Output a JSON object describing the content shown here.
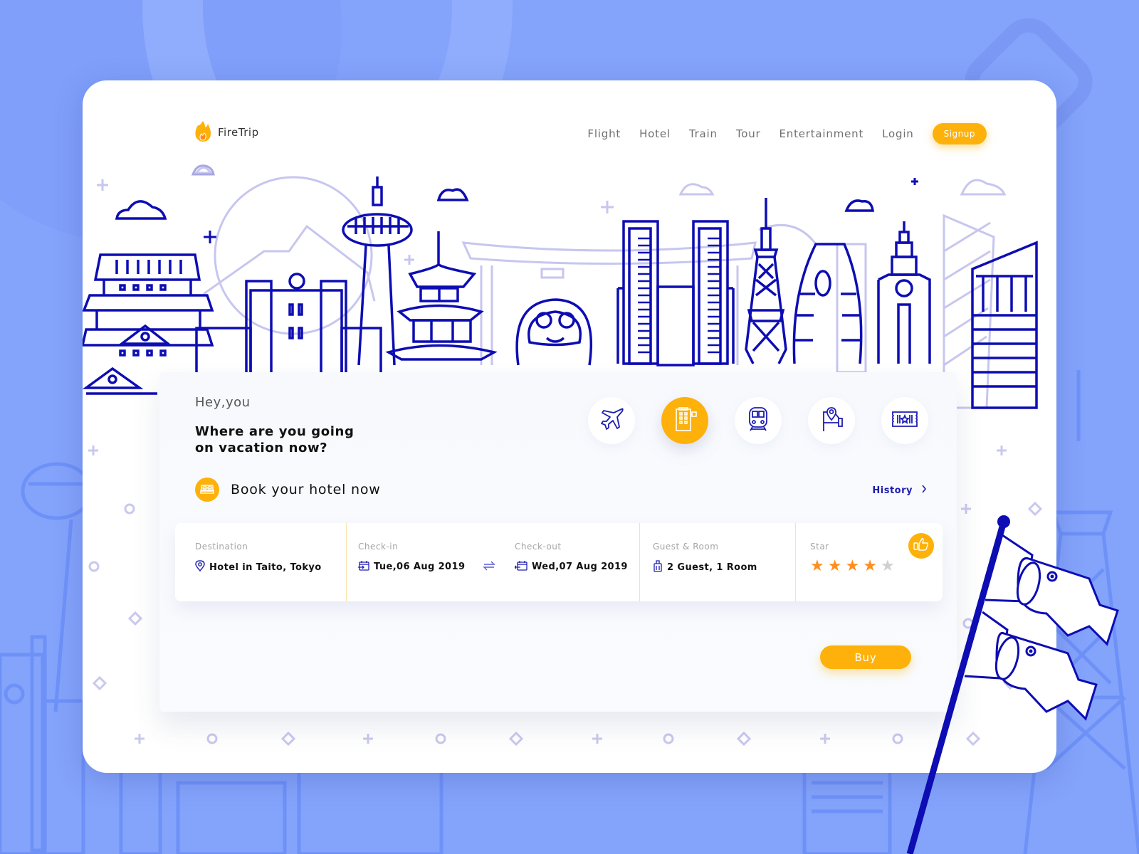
{
  "brand": {
    "name": "FireTrip",
    "icon": "flame-icon",
    "accent": "#fdb10a",
    "ink": "#0d0db3"
  },
  "nav": {
    "links": [
      "Flight",
      "Hotel",
      "Train",
      "Tour",
      "Entertainment",
      "Login"
    ],
    "signup_label": "Signup"
  },
  "hero": {
    "greeting": "Hey,you",
    "question_line1": "Where are you going",
    "question_line2": "on vacation now?"
  },
  "categories": [
    {
      "name": "flight",
      "icon": "airplane-icon",
      "active": false
    },
    {
      "name": "hotel",
      "icon": "hotel-building-icon",
      "active": true
    },
    {
      "name": "train",
      "icon": "train-icon",
      "active": false
    },
    {
      "name": "tour",
      "icon": "map-pin-flag-icon",
      "active": false
    },
    {
      "name": "entertainment",
      "icon": "ticket-icon",
      "active": false
    }
  ],
  "booking": {
    "title": "Book your hotel now",
    "title_icon": "bed-icon",
    "history_label": "History",
    "fields": {
      "destination": {
        "label": "Destination",
        "value": "Hotel in Taito, Tokyo",
        "icon": "location-pin-icon"
      },
      "checkin": {
        "label": "Check-in",
        "value": "Tue,06 Aug 2019",
        "icon": "calendar-in-icon"
      },
      "checkout": {
        "label": "Check-out",
        "value": "Wed,07 Aug 2019",
        "icon": "calendar-out-icon"
      },
      "guest": {
        "label": "Guest & Room",
        "value": "2 Guest, 1 Room",
        "icon": "luggage-icon"
      },
      "star": {
        "label": "Star",
        "rating": 4,
        "max": 5
      }
    },
    "star_color": "#fe8f1e",
    "star_empty_color": "#cfcfcf",
    "buy_label": "Buy"
  }
}
